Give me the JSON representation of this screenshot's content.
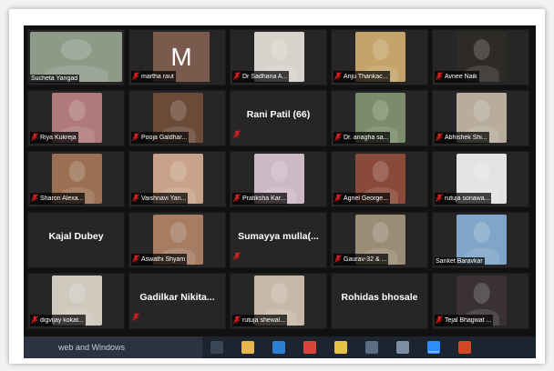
{
  "participants": [
    {
      "name": "Sucheta Yangad",
      "muted": false,
      "kind": "photo",
      "photo": "full",
      "color": "#8e9a88"
    },
    {
      "name": "martha raut",
      "muted": true,
      "kind": "initial",
      "initial": "M",
      "color": "#7a5a4c"
    },
    {
      "name": "Dr Sadhana A...",
      "muted": true,
      "kind": "photo",
      "photo": "center",
      "color": "#d7d3cc"
    },
    {
      "name": "Anju Thankac...",
      "muted": true,
      "kind": "photo",
      "photo": "center",
      "color": "#c4a46a"
    },
    {
      "name": "Avnee Naik",
      "muted": true,
      "kind": "photo",
      "photo": "center",
      "color": "#2e2a26"
    },
    {
      "name": "Riya Kukreja",
      "muted": true,
      "kind": "photo",
      "photo": "center",
      "color": "#b07a7c"
    },
    {
      "name": "Pooja Galdhar...",
      "muted": true,
      "kind": "photo",
      "photo": "center",
      "color": "#6b4a38"
    },
    {
      "name": "Rani Patil (66)",
      "muted": true,
      "kind": "text"
    },
    {
      "name": "Dr. anagha sa...",
      "muted": true,
      "kind": "photo",
      "photo": "center",
      "color": "#7a8c6a"
    },
    {
      "name": "Abhishek Shi...",
      "muted": true,
      "kind": "photo",
      "photo": "center",
      "color": "#b8ad9d"
    },
    {
      "name": "Sharon Alexa...",
      "muted": true,
      "kind": "photo",
      "photo": "center",
      "color": "#9a6f52"
    },
    {
      "name": "Vaishnavi Yan...",
      "muted": true,
      "kind": "photo",
      "photo": "center",
      "color": "#c9a389"
    },
    {
      "name": "Pratiksha Kar...",
      "muted": true,
      "kind": "photo",
      "photo": "center",
      "color": "#cdb9c4"
    },
    {
      "name": "Agnel George...",
      "muted": true,
      "kind": "photo",
      "photo": "center",
      "color": "#8a4a3a"
    },
    {
      "name": "rutuja sonawa...",
      "muted": true,
      "kind": "photo",
      "photo": "center",
      "color": "#e3e3e3"
    },
    {
      "name": "Kajal Dubey",
      "muted": false,
      "kind": "text"
    },
    {
      "name": "Aswathi Shyam",
      "muted": true,
      "kind": "photo",
      "photo": "center",
      "color": "#a67c62"
    },
    {
      "name": "Sumayya mulla(...",
      "muted": true,
      "kind": "text"
    },
    {
      "name": "Gaurav-32 & ...",
      "muted": true,
      "kind": "photo",
      "photo": "center",
      "color": "#9b8c76"
    },
    {
      "name": "Sanket Baravkar",
      "muted": false,
      "kind": "photo",
      "photo": "center",
      "color": "#7fa6c8"
    },
    {
      "name": "digvijay kokat...",
      "muted": true,
      "kind": "photo",
      "photo": "center",
      "color": "#cfc8bd"
    },
    {
      "name": "Gadilkar Nikita...",
      "muted": true,
      "kind": "text"
    },
    {
      "name": "rutuja shewal...",
      "muted": true,
      "kind": "photo",
      "photo": "center",
      "color": "#c8b8a8"
    },
    {
      "name": "Rohidas bhosale",
      "muted": false,
      "kind": "text"
    },
    {
      "name": "Tejal Bhagwat ...",
      "muted": true,
      "kind": "photo",
      "photo": "center",
      "color": "#3a3232"
    }
  ],
  "taskbar": {
    "search_text": "web and Windows",
    "icons": [
      {
        "name": "task-view-icon",
        "color": "#3a4556"
      },
      {
        "name": "file-explorer-icon",
        "color": "#e8b64a"
      },
      {
        "name": "edge-icon",
        "color": "#2d7fd3"
      },
      {
        "name": "chrome-icon",
        "color": "#d9453b"
      },
      {
        "name": "folder-icon",
        "color": "#e9c046"
      },
      {
        "name": "store-icon",
        "color": "#5b6b80"
      },
      {
        "name": "app-icon",
        "color": "#7d8da3"
      },
      {
        "name": "zoom-icon",
        "color": "#2d8cff"
      },
      {
        "name": "powerpoint-icon",
        "color": "#d24726"
      }
    ]
  },
  "colors": {
    "tile_bg": "#262626",
    "grid_bg": "#111111",
    "muted_red": "#e0201c"
  }
}
